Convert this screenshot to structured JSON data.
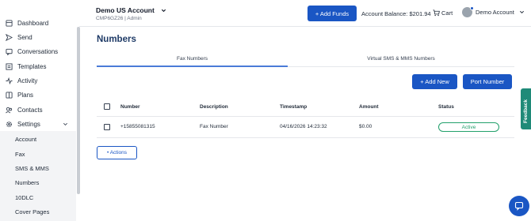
{
  "sidebar": {
    "items": [
      {
        "label": "Dashboard",
        "icon": "dashboard-icon"
      },
      {
        "label": "Send",
        "icon": "send-icon"
      },
      {
        "label": "Conversations",
        "icon": "conversations-icon"
      },
      {
        "label": "Templates",
        "icon": "templates-icon"
      },
      {
        "label": "Activity",
        "icon": "activity-icon"
      },
      {
        "label": "Plans",
        "icon": "plans-icon"
      },
      {
        "label": "Contacts",
        "icon": "contacts-icon"
      },
      {
        "label": "Settings",
        "icon": "gear-icon"
      }
    ],
    "settings_sub": [
      "Account",
      "Fax",
      "SMS & MMS",
      "Numbers",
      "10DLC",
      "Cover Pages"
    ]
  },
  "header": {
    "account_name": "Demo US Account",
    "account_sub": "CMP6GZ26 | Admin",
    "add_funds": "+ Add Funds",
    "balance": "Account Balance: $201.94",
    "cart": "Cart",
    "user": "Demo Account"
  },
  "main": {
    "title": "Numbers",
    "tabs": [
      {
        "label": "Fax Numbers"
      },
      {
        "label": "Virtual SMS & MMS Numbers"
      }
    ],
    "add_new": "+ Add New",
    "port_number": "Port Number",
    "table": {
      "headers": [
        "Number",
        "Description",
        "Timestamp",
        "Amount",
        "Status"
      ],
      "rows": [
        {
          "number": "+15855081315",
          "description": "Fax Number",
          "timestamp": "04/16/2026 14:23:32",
          "amount": "$0.00",
          "status": "Active"
        }
      ]
    },
    "actions": "• Actions"
  },
  "feedback": "Feedback",
  "colors": {
    "primary": "#1a56c4",
    "title": "#1e3a66",
    "active": "#22a06b",
    "feedback": "#1f8a78"
  }
}
